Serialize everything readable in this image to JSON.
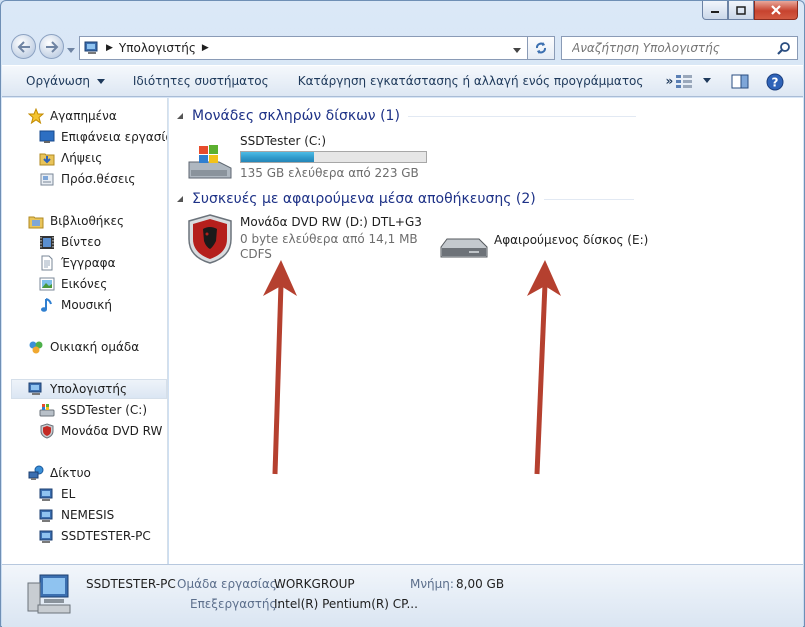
{
  "breadcrumb": {
    "location": "Υπολογιστής"
  },
  "search": {
    "placeholder": "Αναζήτηση Υπολογιστής"
  },
  "toolbar": {
    "organize_label": "Οργάνωση",
    "system_properties_label": "Ιδιότητες συστήματος",
    "uninstall_label": "Κατάργηση εγκατάστασης ή αλλαγή ενός προγράμματος",
    "more_label": "»"
  },
  "sidebar": {
    "favorites": {
      "label": "Αγαπημένα",
      "items": [
        "Επιφάνεια εργασίας",
        "Λήψεις",
        "Πρόσ.θέσεις"
      ]
    },
    "libraries": {
      "label": "Βιβλιοθήκες",
      "items": [
        "Βίντεο",
        "Έγγραφα",
        "Εικόνες",
        "Μουσική"
      ]
    },
    "homegroup": {
      "label": "Οικιακή ομάδα"
    },
    "computer": {
      "label": "Υπολογιστής",
      "items": [
        "SSDTester (C:)",
        "Μονάδα DVD RW (D"
      ]
    },
    "network": {
      "label": "Δίκτυο",
      "items": [
        "EL",
        "NEMESIS",
        "SSDTESTER-PC"
      ]
    }
  },
  "groups": {
    "hard_disks": {
      "title": "Μονάδες σκληρών δίσκων (1)",
      "drive": {
        "name": "SSDTester (C:)",
        "free_text": "135 GB ελεύθερα από 223 GB",
        "used_fraction": 0.395
      }
    },
    "removable": {
      "title": "Συσκευές με αφαιρούμενα μέσα αποθήκευσης (2)",
      "dvd": {
        "name": "Μονάδα DVD RW (D:) DTL+G3",
        "free_text": "0 byte ελεύθερα από 14,1 MB",
        "fs": "CDFS"
      },
      "removable_disk": {
        "name": "Αφαιρούμενος δίσκος (E:)"
      }
    }
  },
  "details": {
    "computer_name": "SSDTESTER-PC",
    "workgroup_label": "Ομάδα εργασίας:",
    "workgroup_value": "WORKGROUP",
    "memory_label": "Μνήμη:",
    "memory_value": "8,00 GB",
    "processor_label": "Επεξεργαστής:",
    "processor_value": "Intel(R) Pentium(R) CP..."
  },
  "colors": {
    "accent": "#1e3287",
    "arrow": "#b5402f",
    "capacity_bar": "#2f98c9"
  }
}
